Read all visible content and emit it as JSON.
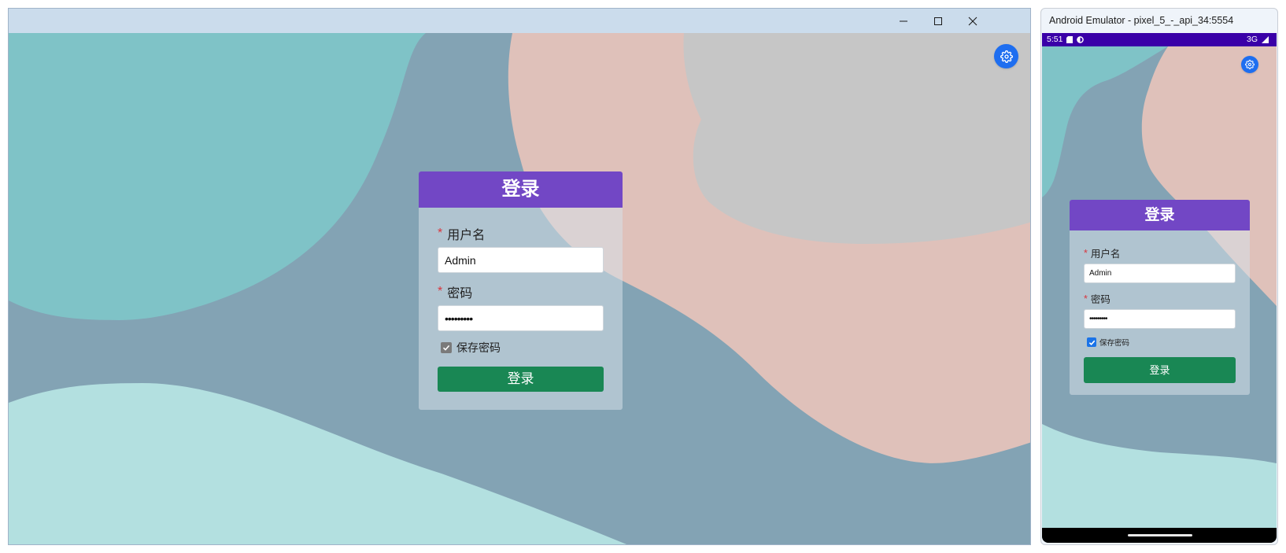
{
  "desktop_window": {
    "controls": [
      "minimize",
      "maximize",
      "close"
    ],
    "settings_icon": "gear-icon",
    "login": {
      "title": "登录",
      "username_label": "用户名",
      "username_value": "Admin",
      "password_label": "密码",
      "password_value": "•••••••••",
      "required_mark": "*",
      "remember_label": "保存密码",
      "remember_checked": true,
      "submit_label": "登录"
    }
  },
  "emulator": {
    "title": "Android Emulator - pixel_5_-_api_34:5554",
    "status_bar": {
      "time": "5:51",
      "network": "3G",
      "left_icons": [
        "sd-card-icon",
        "shield-icon"
      ],
      "right_icons": [
        "signal-icon"
      ]
    },
    "settings_icon": "gear-icon",
    "login": {
      "title": "登录",
      "username_label": "用户名",
      "username_value": "Admin",
      "password_label": "密码",
      "password_value": "•••••••••",
      "required_mark": "*",
      "remember_label": "保存密码",
      "remember_checked": true,
      "submit_label": "登录"
    }
  },
  "colors": {
    "header_purple": "#7247c5",
    "button_green": "#198754",
    "gear_blue": "#1e6ef0",
    "status_bar": "#3a00a8",
    "bg_slate": "#83a3b4",
    "bg_teal": "#7fc3c7",
    "bg_pink": "#dfc1ba",
    "bg_gray": "#c6c6c6",
    "bg_mint": "#b3e0e0"
  }
}
